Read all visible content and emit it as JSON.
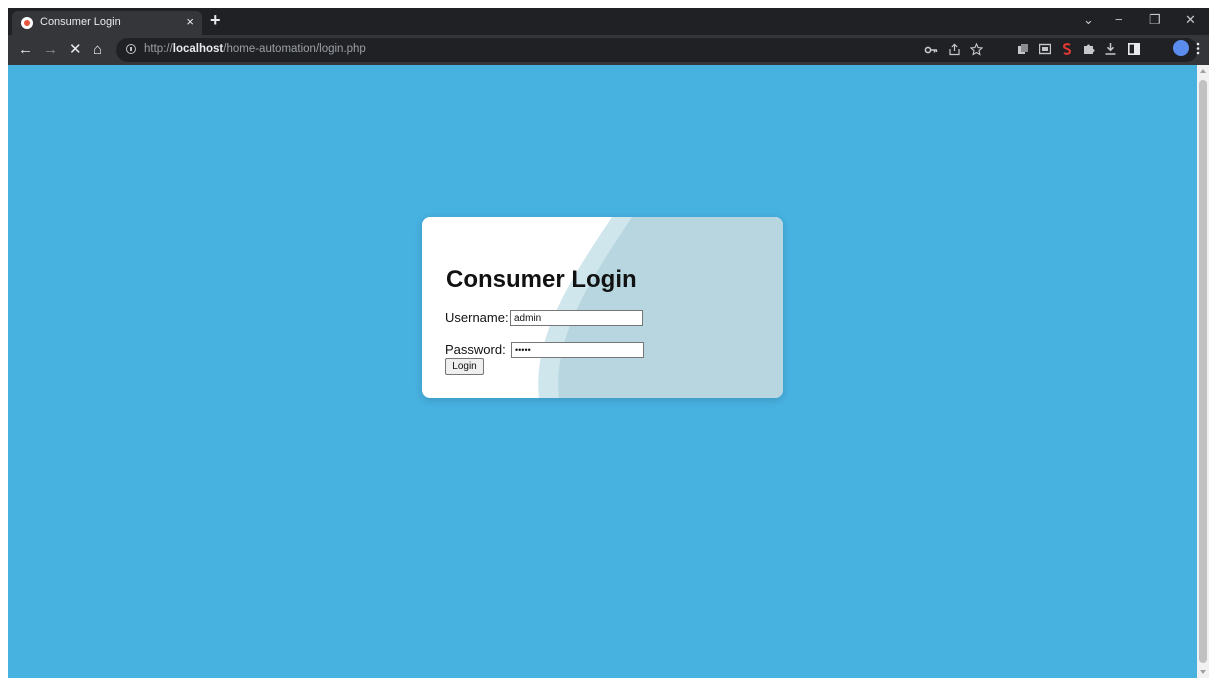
{
  "browser": {
    "tab_title": "Consumer Login",
    "tab_close": "×",
    "new_tab": "+",
    "url_protocol": "http://",
    "url_host": "localhost",
    "url_path": "/home-automation/login.php",
    "controls": {
      "dropdown": "⌄",
      "minimize": "−",
      "restore": "❐",
      "close": "✕"
    },
    "nav": {
      "back": "←",
      "forward": "→",
      "stop": "✕",
      "home": "⌂"
    },
    "toolbar_icons": [
      "key-icon",
      "share-icon",
      "bookmark-star-icon",
      "extension-icon",
      "extension-icon",
      "extension-red-icon",
      "puzzle-icon",
      "download-icon",
      "sidepanel-icon",
      "profile-avatar",
      "menu-icon"
    ]
  },
  "page": {
    "background_color": "#47b1e0",
    "form": {
      "heading": "Consumer Login",
      "username_label": "Username:",
      "username_value": "admin",
      "password_label": "Password:",
      "password_value": "admin",
      "login_label": "Login"
    }
  }
}
